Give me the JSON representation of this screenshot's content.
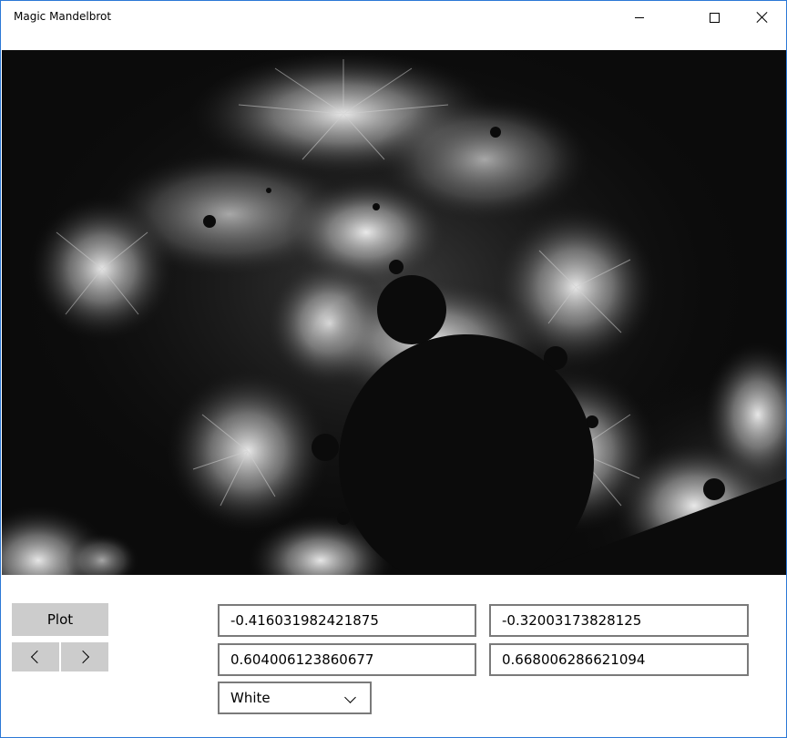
{
  "window": {
    "title": "Magic Mandelbrot"
  },
  "controls": {
    "plot_label": "Plot",
    "prev_icon": "chevron-left-icon",
    "next_icon": "chevron-right-icon",
    "coord_1": "-0.416031982421875",
    "coord_2": "-0.32003173828125",
    "coord_3": "0.604006123860677",
    "coord_4": "0.668006286621094",
    "color_selected": "White"
  },
  "colors": {
    "window_border": "#2b78d6",
    "button_bg": "#cccccc",
    "field_border": "#7a7a7a",
    "fractal_background": "#0b0b0b",
    "fractal_highlight": "#e0e0e0"
  }
}
